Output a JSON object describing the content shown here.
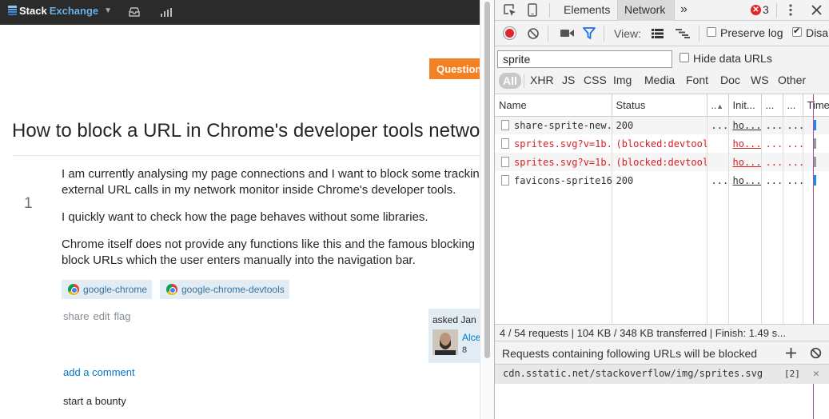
{
  "page": {
    "brand_a": "Stack",
    "brand_b": "Exchange",
    "ask_button": "Question",
    "title": "How to block a URL in Chrome's developer tools netwo",
    "vote_count": "1",
    "paragraphs": [
      "I am currently analysing my page connections and I want to block some trackin",
      "external URL calls in my network monitor inside Chrome's developer tools.",
      "I quickly want to check how the page behaves without some libraries.",
      "Chrome itself does not provide any functions like this and the famous blocking",
      "block URLs which the user enters manually into the navigation bar."
    ],
    "tags": [
      "google-chrome",
      "google-chrome-devtools"
    ],
    "post_menu": [
      "share",
      "edit",
      "flag"
    ],
    "asked": "asked Jan",
    "user_name": "Alce",
    "user_rep": "8",
    "add_comment": "add a comment",
    "bounty": "start a bounty"
  },
  "devtools": {
    "tabs": [
      "Elements",
      "Network"
    ],
    "more": "»",
    "error_count": "3",
    "view_label": "View:",
    "preserve_log": "Preserve log",
    "disable_cache": "Disa",
    "filter_value": "sprite",
    "hide_data_urls": "Hide data URLs",
    "types": [
      "All",
      "XHR",
      "JS",
      "CSS",
      "Img",
      "Media",
      "Font",
      "Doc",
      "WS",
      "Other"
    ],
    "columns": [
      "Name",
      "Status",
      "",
      "Init...",
      "...",
      "...",
      "Timel"
    ],
    "rows": [
      {
        "name": "share-sprite-new...",
        "status": "200",
        "dots": "...",
        "init": "ho...",
        "c5": "...",
        "c6": "...",
        "blocked": false,
        "bar": "blue"
      },
      {
        "name": "sprites.svg?v=1b...",
        "status": "(blocked:devtools)",
        "dots": "",
        "init": "ho...",
        "c5": "...",
        "c6": "...",
        "blocked": true,
        "bar": "grey"
      },
      {
        "name": "sprites.svg?v=1b...",
        "status": "(blocked:devtools)",
        "dots": "",
        "init": "ho...",
        "c5": "...",
        "c6": "...",
        "blocked": true,
        "bar": "grey"
      },
      {
        "name": "favicons-sprite16...",
        "status": "200",
        "dots": "...",
        "init": "ho...",
        "c5": "...",
        "c6": "...",
        "blocked": false,
        "bar": "blue"
      }
    ],
    "summary": "4 / 54 requests  |  104 KB / 348 KB transferred  |  Finish: 1.49 s...",
    "blocked_header": "Requests containing following URLs will be blocked",
    "blocked_url": "cdn.sstatic.net/stackoverflow/img/sprites.svg",
    "blocked_count": "[2]",
    "colors": {
      "record": "#e0252b",
      "blocked_text": "#d71f1f",
      "filter_active": "#1a73e8",
      "accent_orange": "#f48024"
    }
  }
}
